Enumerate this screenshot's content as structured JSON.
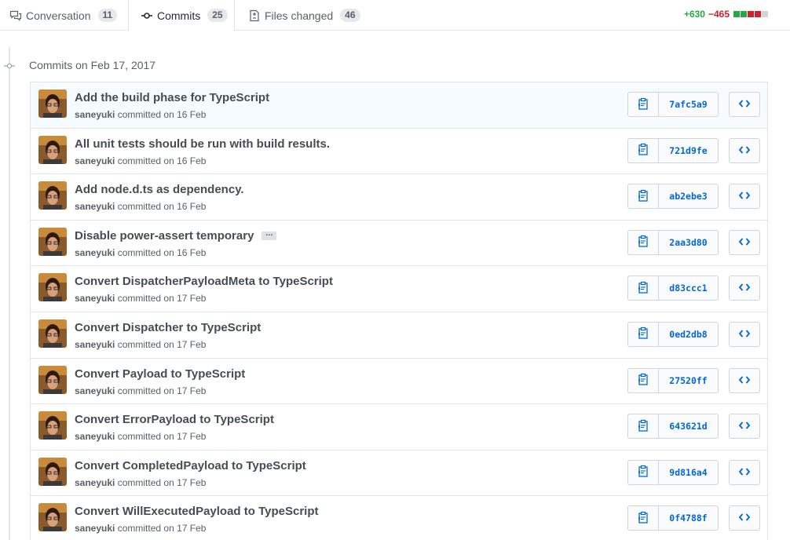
{
  "tabs": [
    {
      "label": "Conversation",
      "count": "11",
      "icon": "comment-discussion-icon"
    },
    {
      "label": "Commits",
      "count": "25",
      "icon": "git-commit-icon"
    },
    {
      "label": "Files changed",
      "count": "46",
      "icon": "file-diff-icon"
    }
  ],
  "diffstat": {
    "additions": "+630",
    "deletions": "−465",
    "blocks": [
      "add",
      "add",
      "del",
      "del",
      "neutral"
    ],
    "colors": {
      "add": "#28a745",
      "del": "#cb2431",
      "neutral": "#d1d5da"
    }
  },
  "timeline": {
    "day_label": "Commits on Feb 17, 2017",
    "commits": [
      {
        "message": "Add the build phase for TypeScript",
        "author": "saneyuki",
        "action": "committed on 16 Feb",
        "sha": "7afc5a9",
        "expandable": false
      },
      {
        "message": "All unit tests should be run with build results.",
        "author": "saneyuki",
        "action": "committed on 16 Feb",
        "sha": "721d9fe",
        "expandable": false
      },
      {
        "message": "Add node.d.ts as dependency.",
        "author": "saneyuki",
        "action": "committed on 16 Feb",
        "sha": "ab2ebe3",
        "expandable": false
      },
      {
        "message": "Disable power-assert temporary",
        "author": "saneyuki",
        "action": "committed on 16 Feb",
        "sha": "2aa3d80",
        "expandable": true,
        "ellipsis": "…"
      },
      {
        "message": "Convert DispatcherPayloadMeta to TypeScript",
        "author": "saneyuki",
        "action": "committed on 17 Feb",
        "sha": "d83ccc1",
        "expandable": false
      },
      {
        "message": "Convert Dispatcher to TypeScript",
        "author": "saneyuki",
        "action": "committed on 17 Feb",
        "sha": "0ed2db8",
        "expandable": false
      },
      {
        "message": "Convert Payload to TypeScript",
        "author": "saneyuki",
        "action": "committed on 17 Feb",
        "sha": "27520ff",
        "expandable": false
      },
      {
        "message": "Convert ErrorPayload to TypeScript",
        "author": "saneyuki",
        "action": "committed on 17 Feb",
        "sha": "643621d",
        "expandable": false
      },
      {
        "message": "Convert CompletedPayload to TypeScript",
        "author": "saneyuki",
        "action": "committed on 17 Feb",
        "sha": "9d816a4",
        "expandable": false
      },
      {
        "message": "Convert WillExecutedPayload to TypeScript",
        "author": "saneyuki",
        "action": "committed on 17 Feb",
        "sha": "0f4788f",
        "expandable": false
      }
    ]
  },
  "icons": {
    "copy": "clippy-icon",
    "browse": "code-icon",
    "day": "git-commit-icon"
  },
  "colors": {
    "link": "#0366d6",
    "highlight_row": "#f6fbff"
  }
}
